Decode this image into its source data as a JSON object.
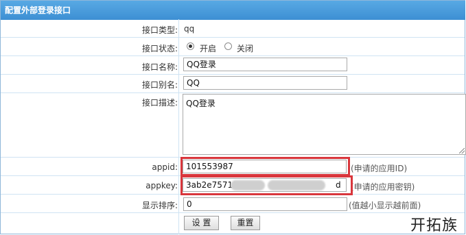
{
  "title": "配置外部登录接口",
  "fields": {
    "type": {
      "label": "接口类型:",
      "value": "qq"
    },
    "status": {
      "label": "接口状态:",
      "on_label": "开启",
      "off_label": "关闭",
      "selected": "开启"
    },
    "name": {
      "label": "接口名称:",
      "value": "QQ登录"
    },
    "alias": {
      "label": "接口别名:",
      "value": "QQ"
    },
    "desc": {
      "label": "接口描述:",
      "value": "QQ登录"
    },
    "appid": {
      "label": "appid:",
      "value": "101553987",
      "hint": "(申请的应用ID)"
    },
    "appkey": {
      "label": "appkey:",
      "value_start": "3ab2e75711",
      "value_end": "d",
      "hint": "(申请的应用密钥)"
    },
    "order": {
      "label": "显示排序:",
      "value": "0",
      "hint": "(值越小显示越前面)"
    }
  },
  "buttons": {
    "save": "设 置",
    "reset": "重置"
  },
  "watermark": "开拓族",
  "colors": {
    "titlebar": "#4a9bdc",
    "highlight": "#d9363c",
    "row_border": "#cfe3f3"
  }
}
